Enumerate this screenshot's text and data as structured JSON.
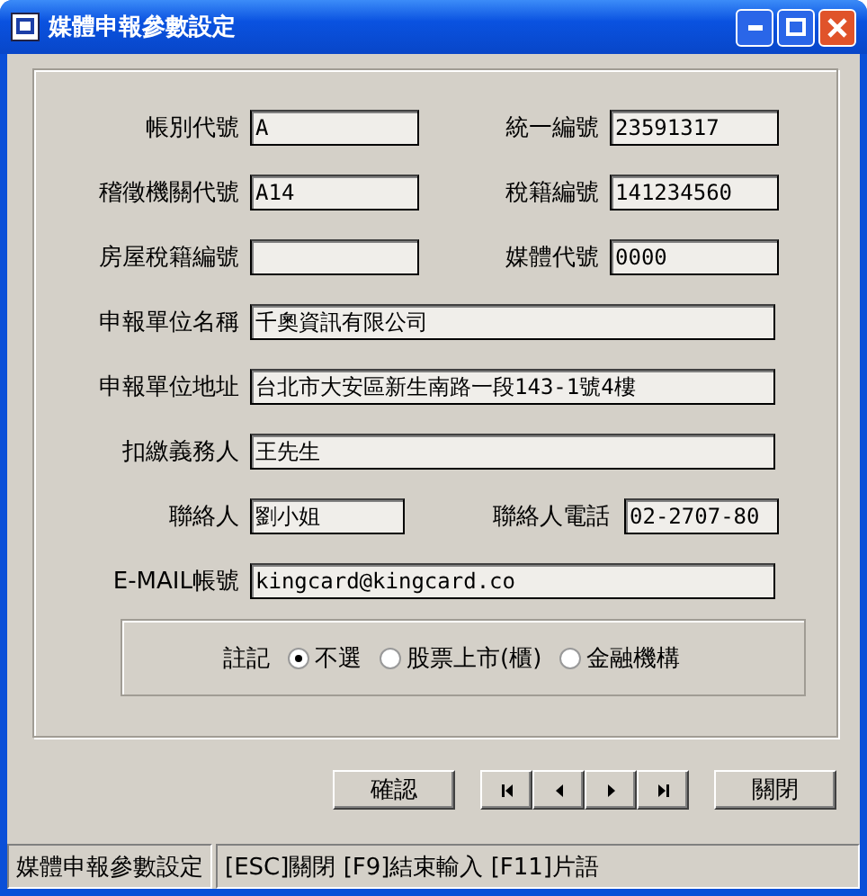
{
  "window": {
    "title": "媒體申報參數設定"
  },
  "rows": [
    {
      "fields": [
        {
          "label": "帳別代號",
          "value": "A",
          "kind": "short"
        },
        {
          "label": "統一編號",
          "value": "23591317",
          "kind": "short"
        }
      ]
    },
    {
      "fields": [
        {
          "label": "稽徵機關代號",
          "value": "A14",
          "kind": "short"
        },
        {
          "label": "稅籍編號",
          "value": "141234560",
          "kind": "short"
        }
      ]
    },
    {
      "fields": [
        {
          "label": "房屋稅籍編號",
          "kind": "short"
        },
        {
          "label": "媒體代號",
          "value": "0000",
          "kind": "short"
        }
      ]
    },
    {
      "fields": [
        {
          "label": "申報單位名稱",
          "value": "千奧資訊有限公司",
          "kind": "wide"
        }
      ]
    },
    {
      "fields": [
        {
          "label": "申報單位地址",
          "value": "台北市大安區新生南路一段143-1號4樓",
          "kind": "wide"
        }
      ]
    },
    {
      "fields": [
        {
          "label": "扣繳義務人",
          "value": "王先生",
          "kind": "wide"
        }
      ]
    },
    {
      "fields": [
        {
          "label": "聯絡人",
          "value": "劉小姐",
          "kind": "narrow"
        },
        {
          "label": "聯絡人電話",
          "value": "02-2707-80",
          "kind": "narrow"
        }
      ]
    },
    {
      "fields": [
        {
          "label": "E-MAIL帳號",
          "value": "kingcard@kingcard.co",
          "kind": "wide"
        }
      ]
    }
  ],
  "remark": {
    "label": "註記",
    "options": [
      {
        "label": "不選",
        "selected": true
      },
      {
        "label": "股票上市(櫃)",
        "selected": false
      },
      {
        "label": "金融機構",
        "selected": false
      }
    ]
  },
  "confirm_button": "確認",
  "nav_buttons": [
    {
      "kind": "first"
    },
    {
      "kind": "prev"
    },
    {
      "kind": "next"
    },
    {
      "kind": "last"
    }
  ],
  "close_button": "關閉",
  "status_bar": [
    "媒體申報參數設定",
    "[ESC]關閉 [F9]結束輸入 [F11]片語"
  ]
}
